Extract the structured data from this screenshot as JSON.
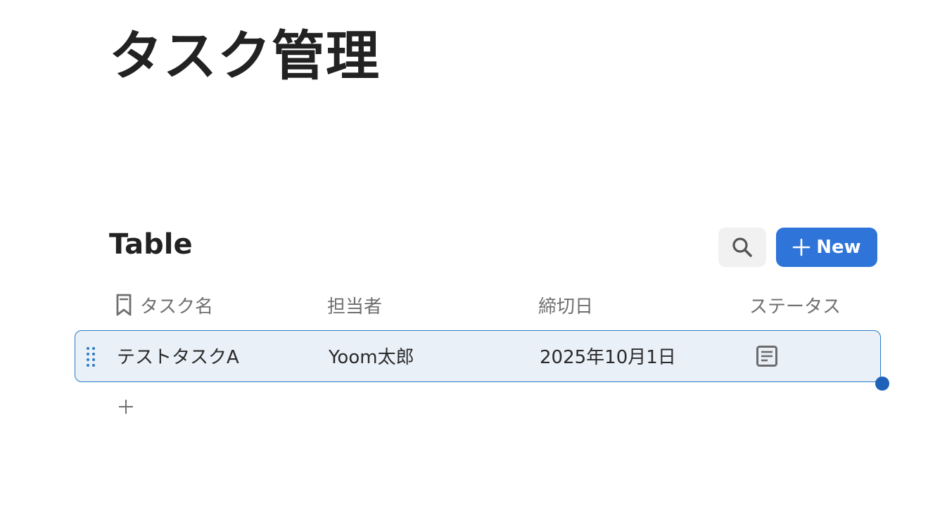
{
  "page": {
    "title": "タスク管理"
  },
  "table": {
    "heading": "Table",
    "new_button_label": "New",
    "search_icon": "search-icon",
    "columns": [
      {
        "label": "タスク名",
        "icon": "bookmark-icon"
      },
      {
        "label": "担当者"
      },
      {
        "label": "締切日"
      },
      {
        "label": "ステータス"
      }
    ],
    "rows": [
      {
        "task_name": "テストタスクA",
        "assignee": "Yoom太郎",
        "due_date": "2025年10月1日",
        "status_icon": "document-icon"
      }
    ],
    "add_row_icon": "plus-icon"
  },
  "colors": {
    "accent": "#2f74d9",
    "row_selected_bg": "#e9f0f8",
    "row_selected_border": "#2b7bc4",
    "handle": "#1e63b8"
  }
}
